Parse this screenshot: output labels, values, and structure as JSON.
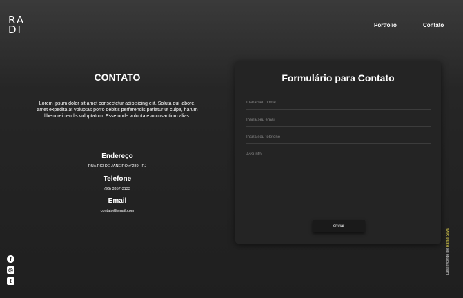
{
  "logo": {
    "line1": "RA",
    "line2": "DI"
  },
  "nav": {
    "portfolio": "Portfólio",
    "contato": "Contato"
  },
  "contact": {
    "title": "CONTATO",
    "description": "Lorem ipsum dolor sit amet consectetur adipisicing elit. Soluta qui labore, amet expedita at voluptas porro debitis perferendis pariatur ut culpa, harum libero reiciendis voluptatum. Esse unde voluptate accusantium alias.",
    "address_title": "Endereço",
    "address_value": "RUA RIO DE JANEIRO nº289 - RJ",
    "phone_title": "Telefone",
    "phone_value": "(96) 3357-3133",
    "email_title": "Email",
    "email_value": "contato@email.com"
  },
  "form": {
    "title": "Formulário para Contato",
    "name_placeholder": "Insira seu nome",
    "email_placeholder": "Insira seu email",
    "phone_placeholder": "Insira seu telefone",
    "subject_placeholder": "Assunto",
    "submit_label": "enviar"
  },
  "social": {
    "facebook": "f",
    "instagram": "◎",
    "twitter": "t"
  },
  "credit": {
    "prefix": "Desenvolvido por",
    "name": "Rafael Silva"
  }
}
